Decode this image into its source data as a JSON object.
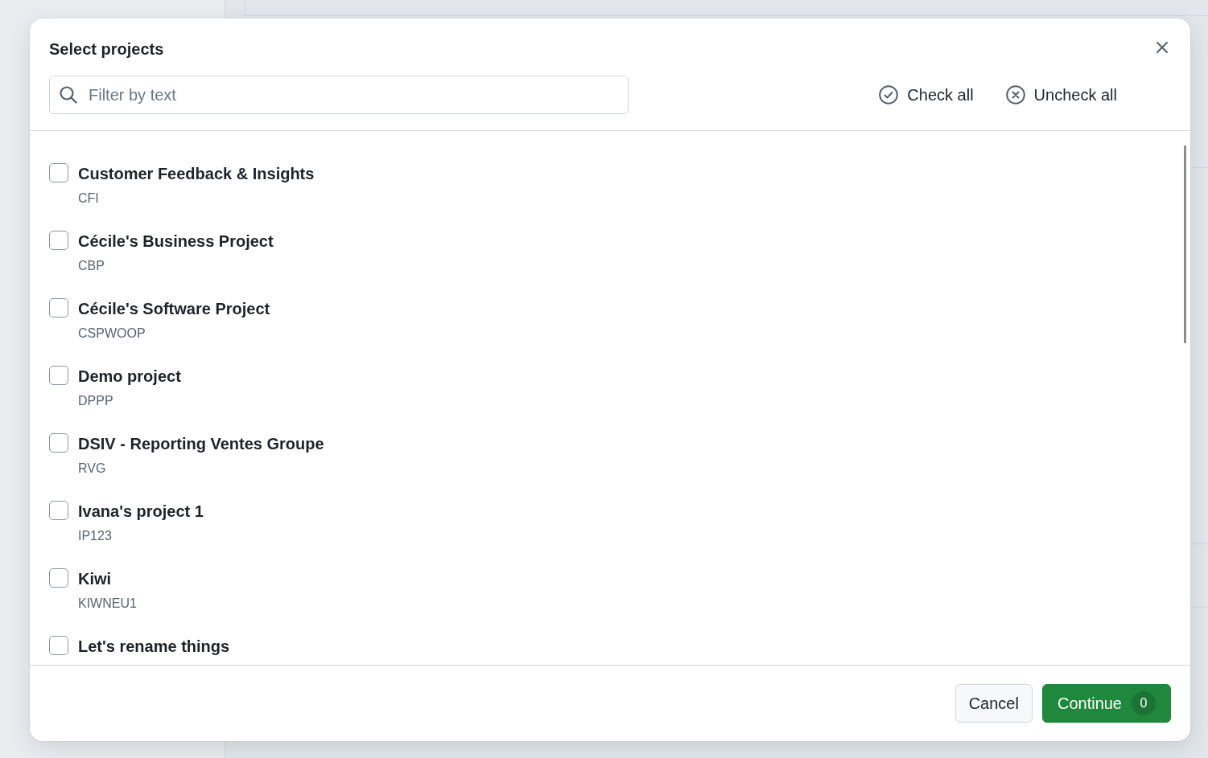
{
  "dialog": {
    "title": "Select projects",
    "search": {
      "placeholder": "Filter by text"
    },
    "actions": [
      {
        "label": "Check all",
        "kind": "check"
      },
      {
        "label": "Uncheck all",
        "kind": "uncheck"
      }
    ],
    "projects": [
      {
        "name": "Customer Feedback & Insights",
        "key": "CFI",
        "checked": false
      },
      {
        "name": "Cécile's Business Project",
        "key": "CBP",
        "checked": false
      },
      {
        "name": "Cécile's Software Project",
        "key": "CSPWOOP",
        "checked": false
      },
      {
        "name": "Demo project",
        "key": "DPPP",
        "checked": false
      },
      {
        "name": "DSIV - Reporting Ventes Groupe",
        "key": "RVG",
        "checked": false
      },
      {
        "name": "Ivana's project 1",
        "key": "IP123",
        "checked": false
      },
      {
        "name": "Kiwi",
        "key": "KIWNEU1",
        "checked": false
      },
      {
        "name": "Let's rename things",
        "checked": false
      }
    ],
    "footer": {
      "buttons": [
        {
          "label": "Cancel",
          "kind": "secondary"
        },
        {
          "label": "Continue",
          "kind": "primary",
          "badge": "0"
        }
      ]
    }
  }
}
